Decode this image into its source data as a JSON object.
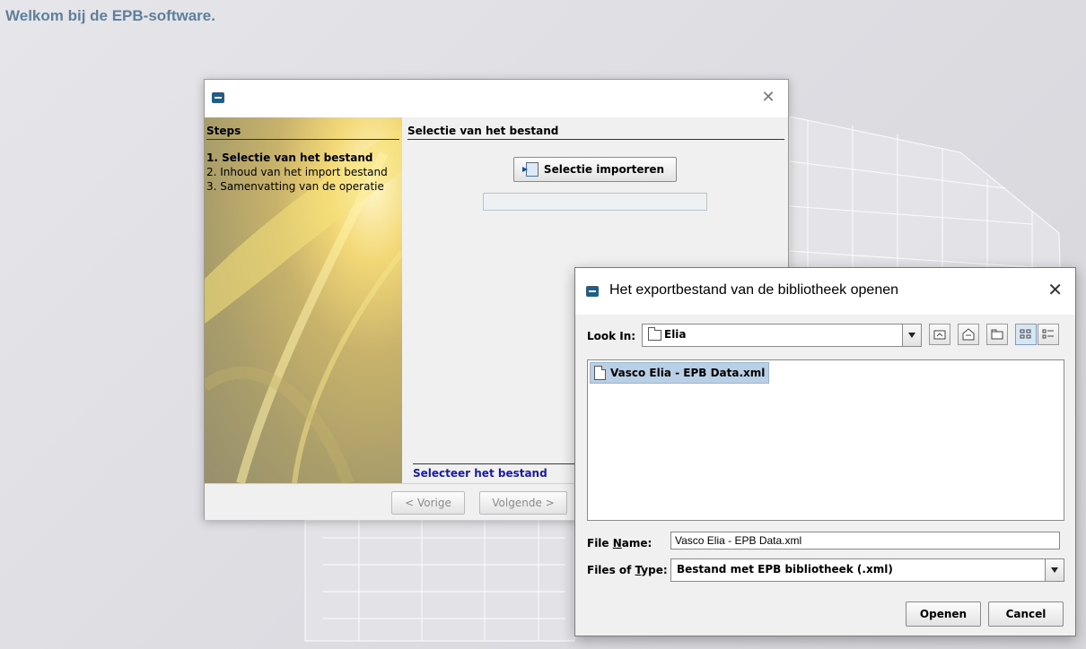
{
  "background": {
    "welcome_text": "Welkom bij de EPB-software."
  },
  "wizard": {
    "steps_header": "Steps",
    "steps": [
      {
        "label": "1. Selectie van het bestand",
        "active": true
      },
      {
        "label": "2. Inhoud van het import bestand",
        "active": false
      },
      {
        "label": "3. Samenvatting van de operatie",
        "active": false
      }
    ],
    "content_header": "Selectie van het bestand",
    "select_button": "Selectie importeren",
    "status_text": "Selecteer het bestand",
    "prev_button": "< Vorige",
    "next_button": "Volgende >"
  },
  "file_dialog": {
    "title": "Het exportbestand van de bibliotheek openen",
    "look_in_label": "Look In:",
    "look_in_value": "Elia",
    "files": [
      {
        "name": "Vasco Elia - EPB Data.xml",
        "selected": true
      }
    ],
    "file_name_label": "File Name:",
    "file_name_value": "Vasco Elia - EPB Data.xml",
    "files_of_type_label": "Files of Type:",
    "files_of_type_value": "Bestand met EPB bibliotheek (.xml)",
    "open_button": "Openen",
    "cancel_button": "Cancel"
  },
  "colors": {
    "welcome": "#5f7f9a",
    "status_text": "#1a1aa8",
    "selection": "#b8cfe5"
  }
}
